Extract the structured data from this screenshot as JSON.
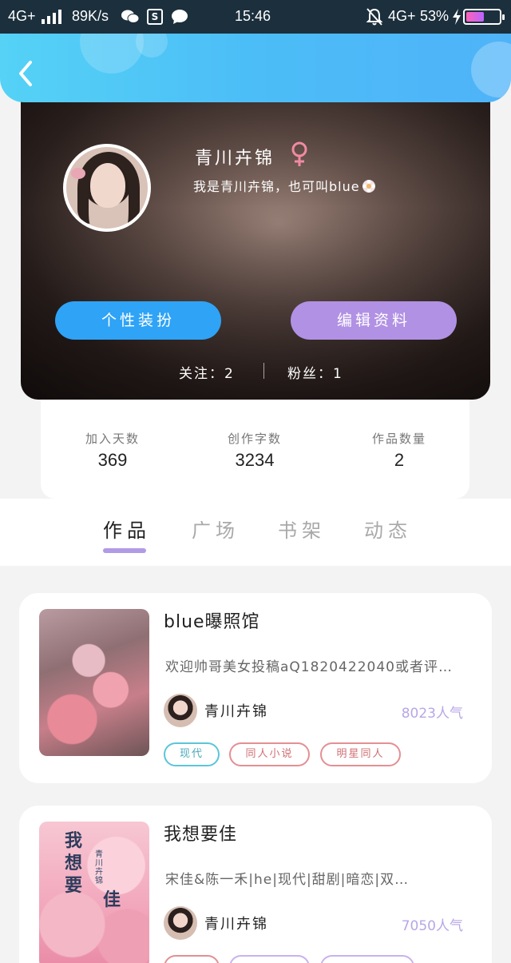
{
  "status_bar": {
    "network": "4G+",
    "speed": "89K/s",
    "time": "15:46",
    "network2": "4G+",
    "battery": "53%"
  },
  "header": {
    "back_icon": "chevron-left-icon"
  },
  "profile": {
    "name": "青川卉锦",
    "gender_icon": "female-icon",
    "bio": "我是青川卉锦，也可叫blue",
    "buttons": {
      "dress_up": "个性装扮",
      "edit_profile": "编辑资料"
    },
    "follow": "关注：2",
    "fans": "粉丝：1"
  },
  "stats": [
    {
      "label": "加入天数",
      "value": "369"
    },
    {
      "label": "创作字数",
      "value": "3234"
    },
    {
      "label": "作品数量",
      "value": "2"
    }
  ],
  "tabs": [
    {
      "label": "作品",
      "active": true
    },
    {
      "label": "广场",
      "active": false
    },
    {
      "label": "书架",
      "active": false
    },
    {
      "label": "动态",
      "active": false
    }
  ],
  "works": [
    {
      "title": "blue曝照馆",
      "description": "欢迎帅哥美女投稿aQ1820422040或者评…",
      "author": "青川卉锦",
      "popularity": "8023人气",
      "tags": [
        "现代",
        "同人小说",
        "明星同人"
      ]
    },
    {
      "title": "我想要佳",
      "description": "宋佳&陈一禾|he|现代|甜剧|暗恋|双…",
      "author": "青川卉锦",
      "popularity": "7050人气",
      "cover_title_vertical": "我想要",
      "cover_title_second": "佳",
      "cover_author": "青川卉锦",
      "tags": [
        "",
        "",
        ""
      ]
    }
  ],
  "colors": {
    "header_blue": "#4cbdf7",
    "dress_button": "#2fa3f6",
    "edit_button": "#b191e4",
    "tab_indicator": "#b19ae6",
    "popularity": "#b8a6e6"
  }
}
